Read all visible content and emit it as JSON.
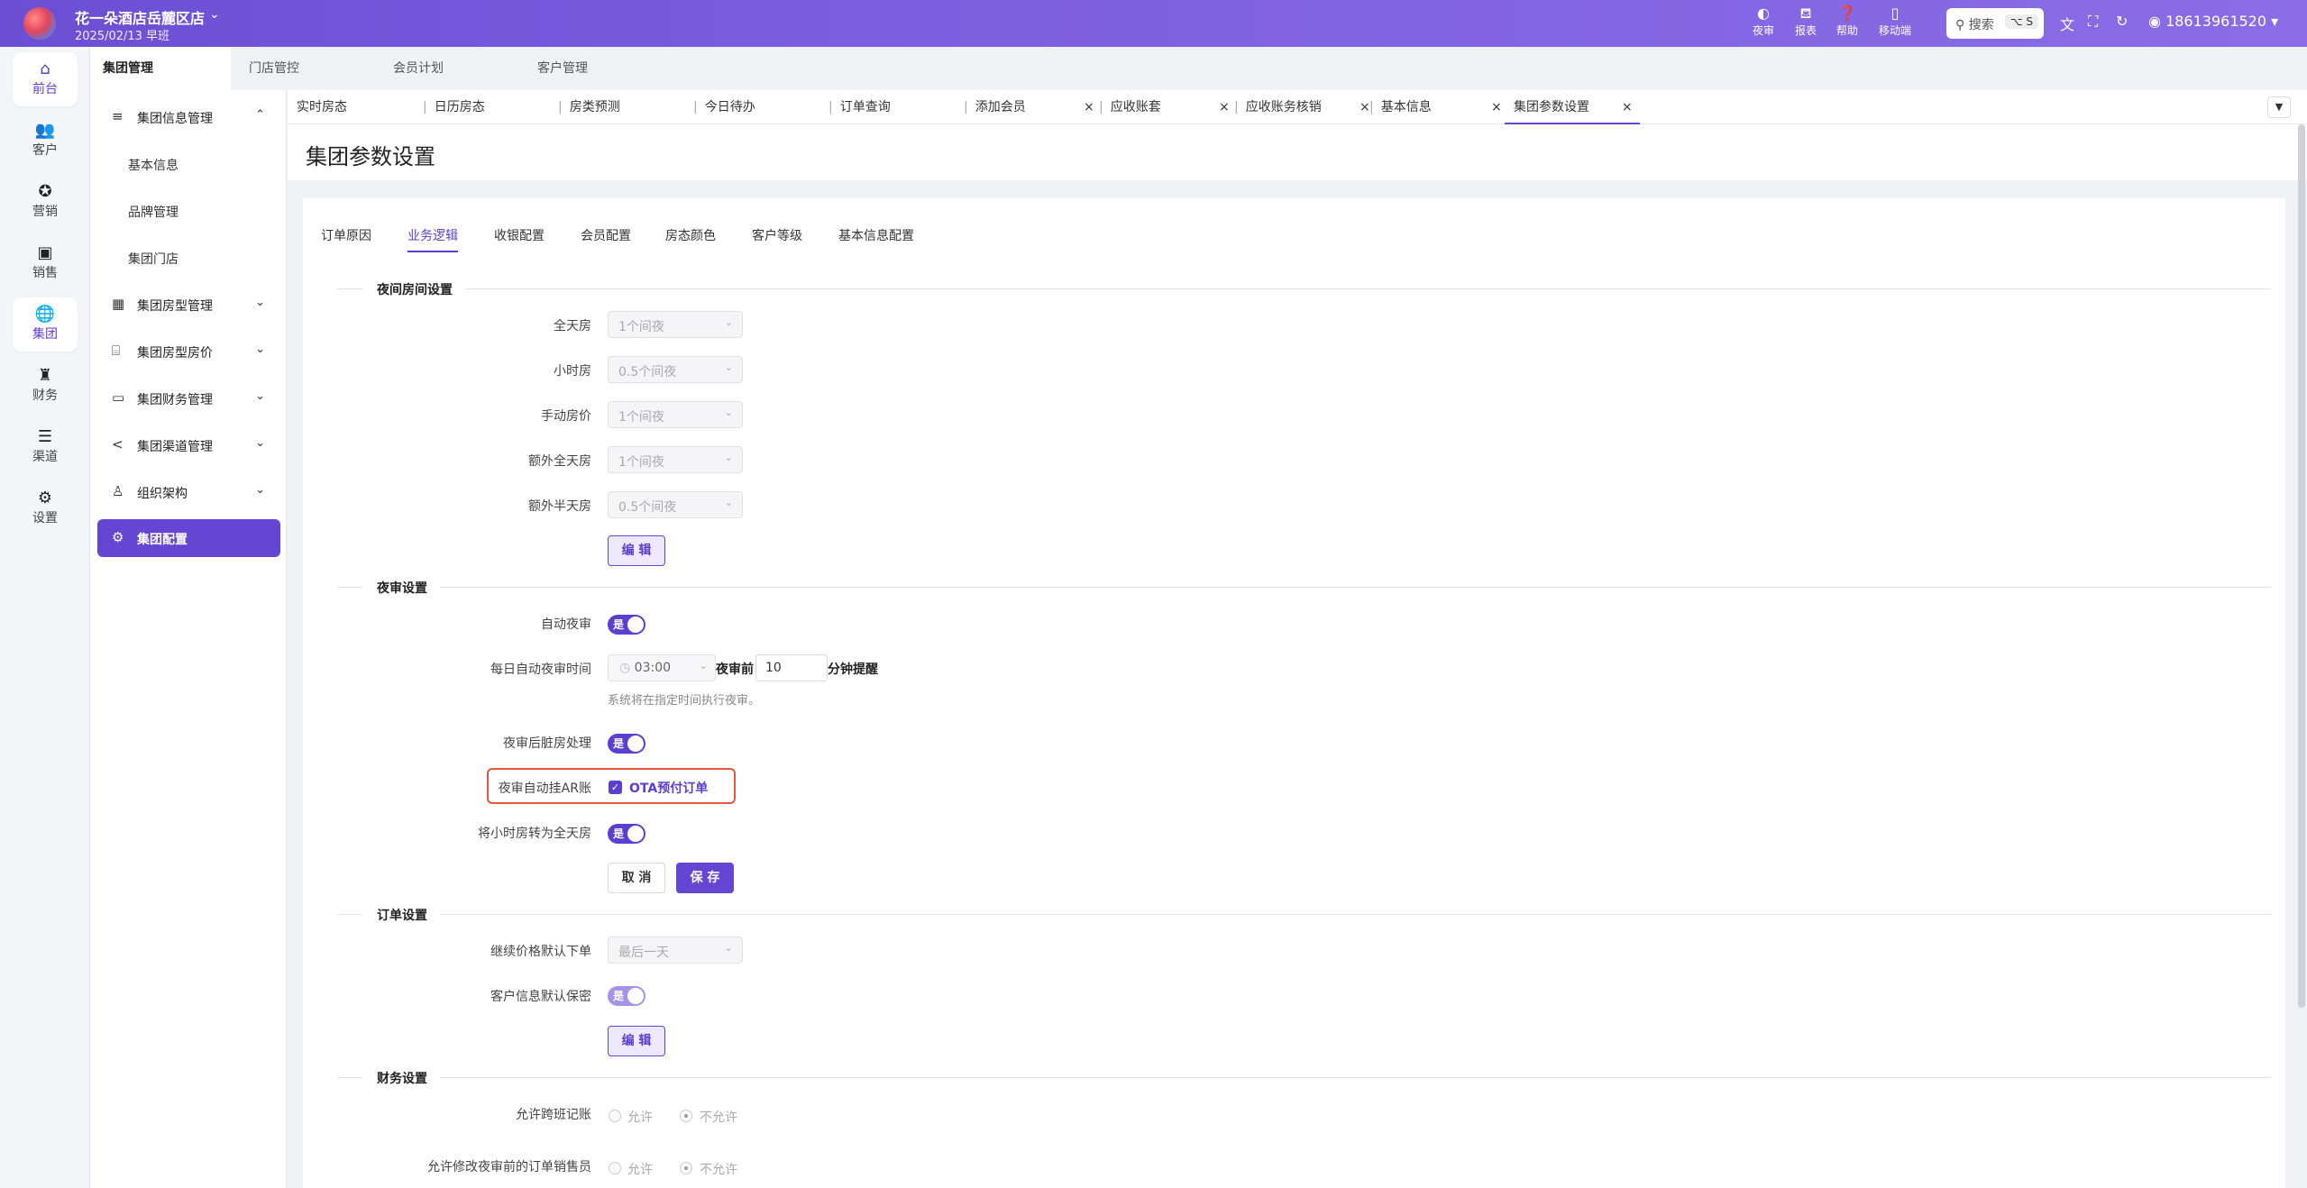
{
  "colors": {
    "brand": "#6a4fd3",
    "accent": "#5b3fd0",
    "highlight_border": "#e8543c"
  },
  "header": {
    "hotel_name": "花一朵酒店岳麓区店",
    "date_shift": "2025/02/13  早班",
    "tools": [
      {
        "icon": "night-audit-icon",
        "label": "夜审"
      },
      {
        "icon": "report-icon",
        "label": "报表"
      },
      {
        "icon": "help-icon",
        "label": "帮助"
      },
      {
        "icon": "mobile-icon",
        "label": "移动端"
      }
    ],
    "search_label": "搜索",
    "search_shortcut": "⌥ S",
    "user_phone": "18613961520"
  },
  "rail": [
    {
      "icon": "home-icon",
      "label": "前台"
    },
    {
      "icon": "customer-icon",
      "label": "客户"
    },
    {
      "icon": "marketing-icon",
      "label": "营销"
    },
    {
      "icon": "sales-icon",
      "label": "销售"
    },
    {
      "icon": "group-icon",
      "label": "集团"
    },
    {
      "icon": "finance-icon",
      "label": "财务"
    },
    {
      "icon": "channel-icon",
      "label": "渠道"
    },
    {
      "icon": "settings-icon",
      "label": "设置"
    }
  ],
  "module_tabs": [
    "集团管理",
    "门店管控",
    "会员计划",
    "客户管理"
  ],
  "sidebar": {
    "info_group": "集团信息管理",
    "info_items": [
      "基本信息",
      "品牌管理",
      "集团门店"
    ],
    "groups": [
      "集团房型管理",
      "集团房型房价",
      "集团财务管理",
      "集团渠道管理",
      "组织架构"
    ],
    "active": "集团配置"
  },
  "page_tabs": [
    "实时房态",
    "日历房态",
    "房类预测",
    "今日待办",
    "订单查询",
    "添加会员",
    "应收账套",
    "应收账务核销",
    "基本信息",
    "集团参数设置"
  ],
  "page_title": "集团参数设置",
  "sub_tabs": [
    "订单原因",
    "业务逻辑",
    "收银配置",
    "会员配置",
    "房态颜色",
    "客户等级",
    "基本信息配置"
  ],
  "night_room": {
    "title": "夜间房间设置",
    "fields": [
      {
        "label": "全天房",
        "value": "1个间夜"
      },
      {
        "label": "小时房",
        "value": "0.5个间夜"
      },
      {
        "label": "手动房价",
        "value": "1个间夜"
      },
      {
        "label": "额外全天房",
        "value": "1个间夜"
      },
      {
        "label": "额外半天房",
        "value": "0.5个间夜"
      }
    ],
    "edit": "编 辑"
  },
  "night_audit": {
    "title": "夜审设置",
    "auto_label": "自动夜审",
    "switch_on": "是",
    "time_label": "每日自动夜审时间",
    "time_value": "03:00",
    "before_label": "夜审前",
    "minutes_value": "10",
    "minutes_suffix": "分钟提醒",
    "hint": "系统将在指定时间执行夜审。",
    "dirty_label": "夜审后脏房处理",
    "ar_label": "夜审自动挂AR账",
    "ar_option": "OTA预付订单",
    "hourly_label": "将小时房转为全天房",
    "cancel": "取 消",
    "save": "保 存"
  },
  "order": {
    "title": "订单设置",
    "price_label": "继续价格默认下单",
    "price_value": "最后一天",
    "privacy_label": "客户信息默认保密",
    "edit": "编 辑"
  },
  "finance": {
    "title": "财务设置",
    "cross_label": "允许跨班记账",
    "modify_label": "允许修改夜审前的订单销售员",
    "allow": "允许",
    "deny": "不允许"
  }
}
